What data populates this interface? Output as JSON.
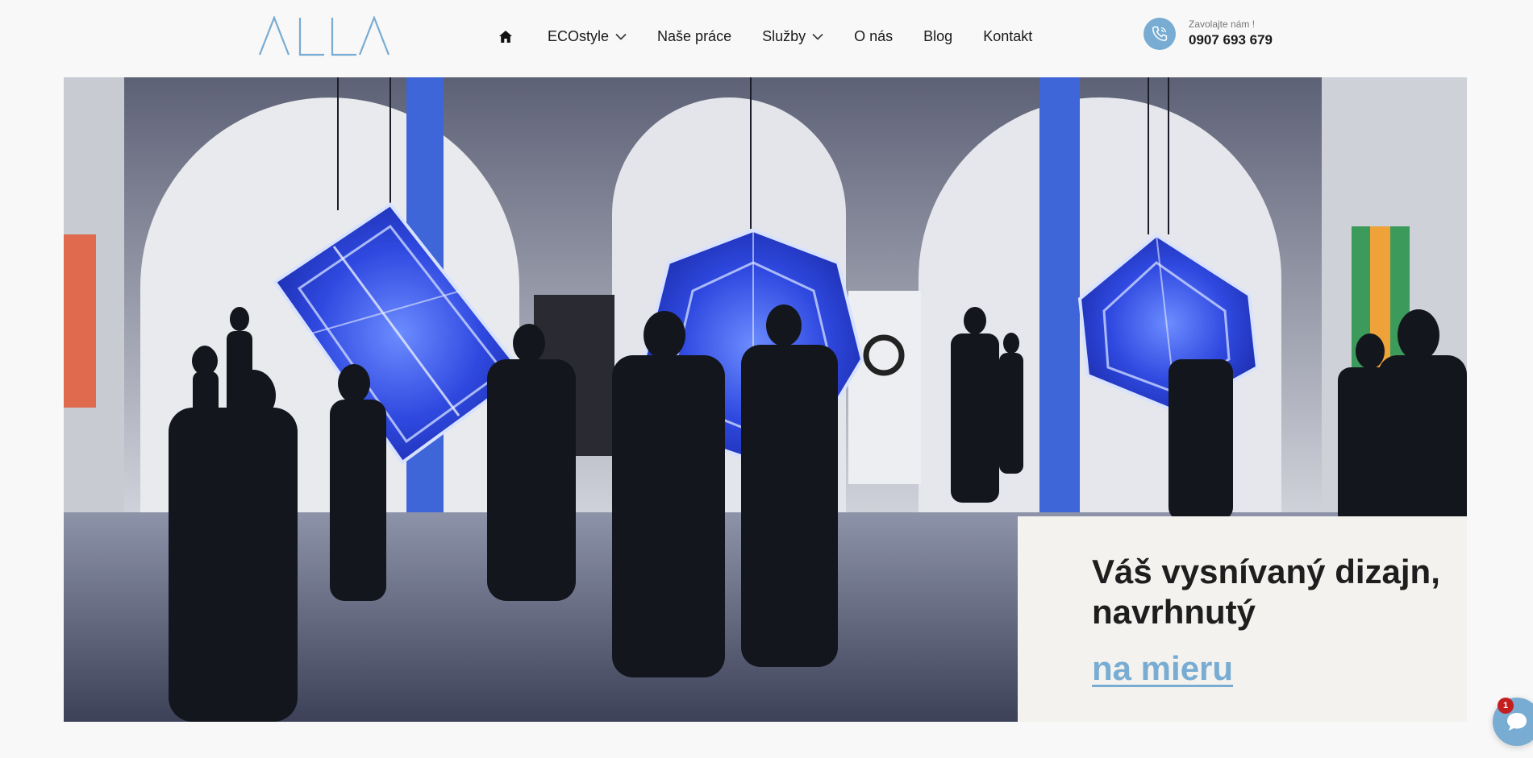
{
  "brand": {
    "logo_text": "ALLA",
    "accent_color": "#78acd2"
  },
  "nav": {
    "home_icon": "home-icon",
    "items": [
      {
        "label": "ECOstyle",
        "has_dropdown": true
      },
      {
        "label": "Naše práce",
        "has_dropdown": false
      },
      {
        "label": "Služby",
        "has_dropdown": true
      },
      {
        "label": "O nás",
        "has_dropdown": false
      },
      {
        "label": "Blog",
        "has_dropdown": false
      },
      {
        "label": "Kontakt",
        "has_dropdown": false
      }
    ]
  },
  "contact": {
    "icon": "phone-icon",
    "label": "Zavolajte nám !",
    "number": "0907 693 679"
  },
  "hero": {
    "image": "gallery-installation-photo",
    "title": "Váš vysnívaný dizajn, navrhnutý",
    "accent": "na mieru"
  },
  "chat": {
    "icon": "chat-bubble-icon",
    "badge_count": "1",
    "badge_color": "#c41e1e"
  }
}
